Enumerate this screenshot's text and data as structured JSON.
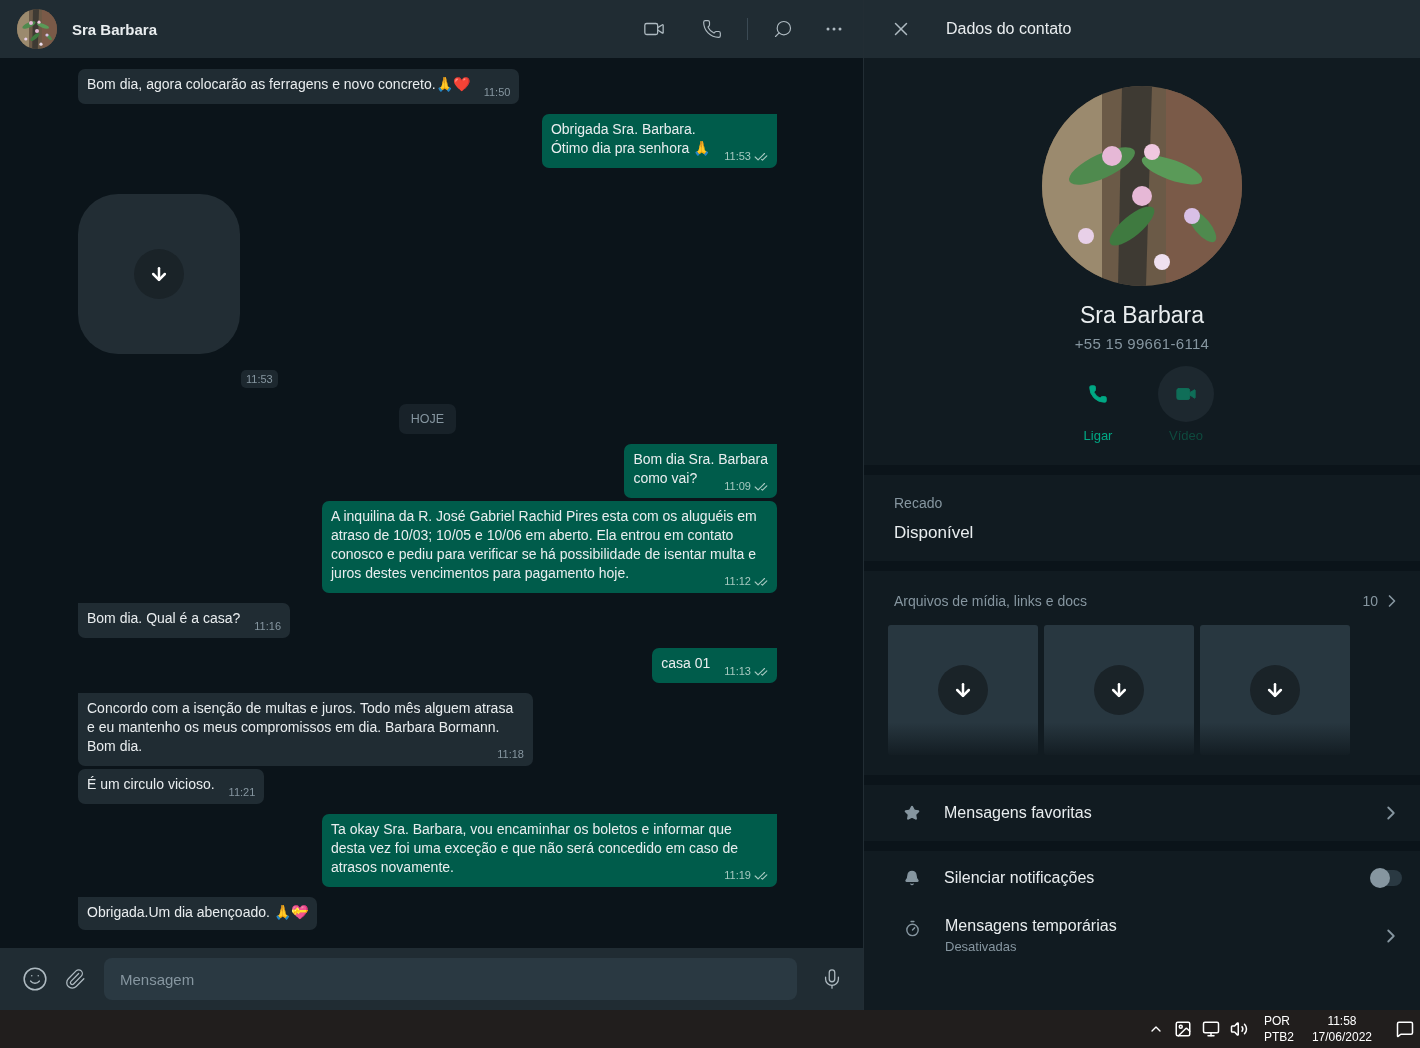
{
  "chat": {
    "header": {
      "name": "Sra Barbara"
    },
    "messages": [
      {
        "kind": "in",
        "tail": false,
        "text": "Bom dia, agora colocarão as ferragens e novo concreto.🙏❤️",
        "time": "11:50"
      },
      {
        "kind": "out",
        "tail": true,
        "text": "Obrigada Sra. Barbara.\nÓtimo dia pra senhora 🙏",
        "time": "11:53"
      },
      {
        "kind": "media",
        "time": "11:53"
      },
      {
        "kind": "date",
        "text": "HOJE"
      },
      {
        "kind": "out",
        "tail": true,
        "text": "Bom dia Sra. Barbara\ncomo vai?",
        "time": "11:09"
      },
      {
        "kind": "out",
        "tail": false,
        "text": "A inquilina da R. José Gabriel Rachid Pires esta com os aluguéis em atraso de 10/03; 10/05 e 10/06 em aberto. Ela entrou em contato conosco e pediu para verificar se há possibilidade de isentar multa e juros destes vencimentos para pagamento hoje.",
        "time": "11:12"
      },
      {
        "kind": "in",
        "tail": true,
        "text": "Bom dia. Qual é a casa?",
        "time": "11:16"
      },
      {
        "kind": "out",
        "tail": true,
        "text": "casa 01",
        "time": "11:13"
      },
      {
        "kind": "in",
        "tail": true,
        "text": "Concordo com a isenção de multas e juros. Todo mês alguem atrasa e eu mantenho os meus compromissos em dia. Barbara Bormann. Bom dia.",
        "time": "11:18"
      },
      {
        "kind": "in",
        "tail": false,
        "text": "É um circulo vicioso.",
        "time": "11:21"
      },
      {
        "kind": "out",
        "tail": true,
        "text": "Ta okay Sra. Barbara, vou encaminhar os boletos e informar que desta vez foi uma exceção e que não será concedido em caso de atrasos novamente.",
        "time": "11:19"
      },
      {
        "kind": "in",
        "tail": true,
        "text": "Obrigada.Um dia abençoado. 🙏💝"
      }
    ],
    "composer": {
      "placeholder": "Mensagem"
    }
  },
  "contact_panel": {
    "title": "Dados do contato",
    "name": "Sra Barbara",
    "phone": "+55 15 99661-6114",
    "actions": [
      {
        "kind": "call",
        "label": "Ligar",
        "disabled": false
      },
      {
        "kind": "video",
        "label": "Vídeo",
        "disabled": true
      }
    ],
    "about": {
      "label": "Recado",
      "value": "Disponível"
    },
    "media": {
      "title": "Arquivos de mídia, links e docs",
      "count": "10",
      "items": [
        {
          "kind": "download"
        },
        {
          "kind": "download"
        },
        {
          "kind": "download"
        }
      ]
    },
    "favorites": {
      "label": "Mensagens favoritas"
    },
    "mute": {
      "label": "Silenciar notificações",
      "on": false
    },
    "disappearing": {
      "label": "Mensagens temporárias",
      "value": "Desativadas"
    }
  },
  "taskbar": {
    "language": [
      "POR",
      "PTB2"
    ],
    "time": "11:58",
    "date": "17/06/2022"
  }
}
